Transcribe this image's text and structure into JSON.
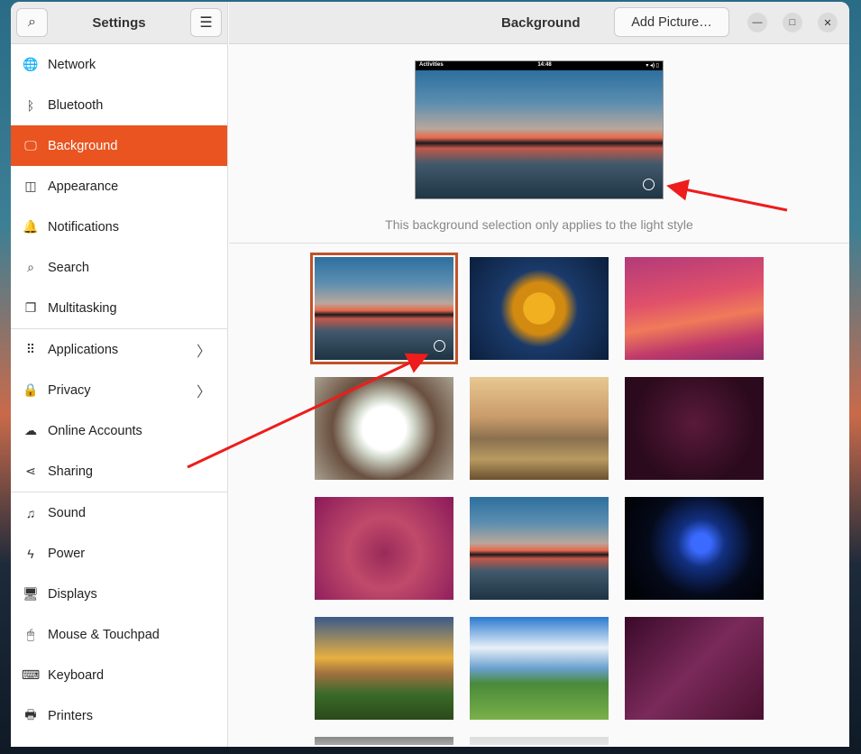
{
  "sidebar": {
    "title": "Settings",
    "items": [
      {
        "label": "Network",
        "icon": "globe-icon",
        "glyph": "🌐"
      },
      {
        "label": "Bluetooth",
        "icon": "bluetooth-icon",
        "glyph": "ᛒ"
      },
      {
        "label": "Background",
        "icon": "background-icon",
        "glyph": "🖵"
      },
      {
        "label": "Appearance",
        "icon": "appearance-icon",
        "glyph": "◫"
      },
      {
        "label": "Notifications",
        "icon": "bell-icon",
        "glyph": "🔔"
      },
      {
        "label": "Search",
        "icon": "search-icon",
        "glyph": "⌕"
      },
      {
        "label": "Multitasking",
        "icon": "multitasking-icon",
        "glyph": "❐"
      },
      {
        "label": "Applications",
        "icon": "apps-icon",
        "glyph": "⠿"
      },
      {
        "label": "Privacy",
        "icon": "lock-icon",
        "glyph": "🔒"
      },
      {
        "label": "Online Accounts",
        "icon": "cloud-icon",
        "glyph": "☁"
      },
      {
        "label": "Sharing",
        "icon": "share-icon",
        "glyph": "⋖"
      },
      {
        "label": "Sound",
        "icon": "music-icon",
        "glyph": "♫"
      },
      {
        "label": "Power",
        "icon": "power-icon",
        "glyph": "ϟ"
      },
      {
        "label": "Displays",
        "icon": "display-icon",
        "glyph": "🖥"
      },
      {
        "label": "Mouse & Touchpad",
        "icon": "mouse-icon",
        "glyph": "🖱"
      },
      {
        "label": "Keyboard",
        "icon": "keyboard-icon",
        "glyph": "⌨"
      },
      {
        "label": "Printers",
        "icon": "printer-icon",
        "glyph": "🖶"
      }
    ]
  },
  "header": {
    "title": "Background",
    "add_label": "Add Picture…"
  },
  "preview": {
    "activities": "Activities",
    "time": "14:48",
    "status": "▾ ◂) ▯"
  },
  "note": "This background selection only applies to the light style",
  "colors": {
    "accent": "#e95420"
  }
}
